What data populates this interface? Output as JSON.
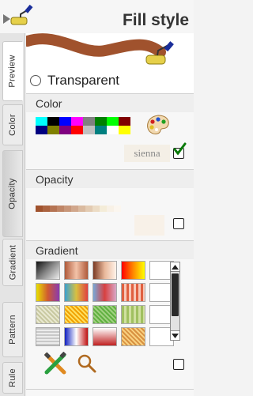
{
  "header": {
    "title": "Fill style"
  },
  "tabs": [
    {
      "label": "Preview",
      "state": "active"
    },
    {
      "label": "Color",
      "state": "normal"
    },
    {
      "label": "Opacity",
      "state": "normal"
    },
    {
      "label": "Gradient",
      "state": "normal"
    },
    {
      "label": "Pattern",
      "state": "normal"
    },
    {
      "label": "Rule",
      "state": "normal"
    }
  ],
  "preview": {
    "fill_color": "#a0522d",
    "transparent_label": "Transparent"
  },
  "color": {
    "title": "Color",
    "palette": [
      "#00ffff",
      "#000000",
      "#0000ff",
      "#ff00ff",
      "#808080",
      "#008000",
      "#00ff00",
      "#800000",
      "#000080",
      "#808000",
      "#800080",
      "#ff0000",
      "#c0c0c0",
      "#008080",
      "#ffffff",
      "#ffff00"
    ],
    "current_value": "sienna",
    "checked": true
  },
  "opacity": {
    "title": "Opacity",
    "strip": [
      "#a0522d",
      "#ab6340",
      "#b57453",
      "#bf8566",
      "#c89679",
      "#d1a78c",
      "#daba9f",
      "#e3cbb2",
      "#ecdcc5",
      "#f4ecd8",
      "#f8f1e6",
      "#fbf6ef"
    ],
    "checked": false
  },
  "gradient": {
    "title": "Gradient",
    "swatches": [
      "linear-gradient(135deg, #111 0%, #888 50%, #eee 100%)",
      "linear-gradient(to right, #b05a3a, #f2c2a8, #b05a3a)",
      "linear-gradient(to right, #7a3a24, #e9b89a, #fff3ea)",
      "linear-gradient(to right, #ff0000, #ff8800, #ffff00)",
      "linear-gradient(to right, #ffffff, #ffffff)",
      "linear-gradient(to right, #e8e000, #d05a30, #8a3ab0)",
      "linear-gradient(to right, #3aa0d0, #d8c040, #e04040)",
      "linear-gradient(to right, #78a8d8, #d84040, #d8a8c8)",
      "repeating-linear-gradient(to right, #e06040 0 3px, #f8c8b8 3px 6px)",
      "linear-gradient(to right, #ffffff, #ffffff)",
      "repeating-linear-gradient(45deg, #c8c8a0 0 2px, #e8e8d0 2px 4px)",
      "repeating-linear-gradient(45deg, #f0a000 0 2px, #ffe060 2px 4px)",
      "repeating-linear-gradient(45deg, #60b040 0 2px, #a0d080 2px 4px)",
      "repeating-linear-gradient(90deg, #a0c060 0 3px, #d0e0a0 3px 6px)",
      "linear-gradient(to right, #ffffff, #ffffff)",
      "repeating-linear-gradient(0deg, #c8c8c8 0 2px, #ececec 2px 4px)",
      "linear-gradient(to right, #1020c0, #ffffff, #c01010)",
      "linear-gradient(to bottom, #ffffff, #c02020)",
      "repeating-linear-gradient(45deg, #d89040 0 2px, #f8d080 2px 4px)",
      "linear-gradient(to right, #ffffff, #ffffff)"
    ],
    "checked": false
  },
  "icons": {
    "header": "paint-roller-icon",
    "preview_roller": "paint-roller-icon",
    "palette": "palette-icon",
    "tools": "color-tools-icon",
    "magnifier": "magnifier-icon"
  },
  "colors": {
    "accent": "#a0522d",
    "check": "#0a7a0a"
  }
}
